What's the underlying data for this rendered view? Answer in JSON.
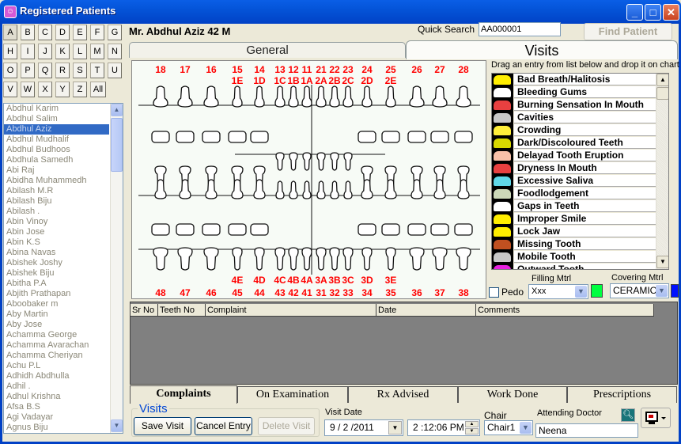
{
  "window": {
    "title": "Registered Patients",
    "buttons": {
      "minimize": "_",
      "maximize": "□",
      "close": "✕"
    }
  },
  "alphabet": [
    "A",
    "B",
    "C",
    "D",
    "E",
    "F",
    "G",
    "H",
    "I",
    "J",
    "K",
    "L",
    "M",
    "N",
    "O",
    "P",
    "Q",
    "R",
    "S",
    "T",
    "U",
    "V",
    "W",
    "X",
    "Y",
    "Z",
    "All"
  ],
  "alphabet_selected": "A",
  "patients": [
    "Abdhul Karim",
    "Abdhul Salim",
    "Abdhul Aziz",
    "Abdhul Mudhalif",
    "Abdhul Budhoos",
    "Abdhula Samedh",
    "Abi Raj",
    "Abidha Muhammedh",
    "Abilash M.R",
    "Abilash Biju",
    "Abilash .",
    "Abin Vinoy",
    "Abin Jose",
    "Abin K.S",
    "Abina Navas",
    "Abishek Joshy",
    "Abishek Biju",
    "Abitha P.A",
    "Abjith Prathapan",
    "Aboobaker m",
    "Aby Martin",
    "Aby Jose",
    "Achamma George",
    "Achamma Avarachan",
    "Achamma Cheriyan",
    "Achu P.L",
    "Adhidh Abdhulla",
    "Adhil .",
    "Adhul Krishna",
    "Afsa B.S",
    "Agi Vadayar",
    "Agnus Biju"
  ],
  "selected_patient_index": 2,
  "patient_header": "Mr. Abdhul  Aziz 42 M",
  "quick_search": {
    "label": "Quick Search",
    "value": "AA000001"
  },
  "find_patient_label": "Find Patient",
  "top_tabs": [
    {
      "label": "General",
      "active": false
    },
    {
      "label": "Visits",
      "active": true
    }
  ],
  "tooth_chart": {
    "upper_permanent": [
      "18",
      "17",
      "16",
      "15",
      "14",
      "13",
      "12",
      "11",
      "21",
      "22",
      "23",
      "24",
      "25",
      "26",
      "27",
      "28"
    ],
    "upper_primary": [
      "1E",
      "1D",
      "1C",
      "1B",
      "1A",
      "2A",
      "2B",
      "2C",
      "2D",
      "2E"
    ],
    "lower_primary": [
      "4E",
      "4D",
      "4C",
      "4B",
      "4A",
      "3A",
      "3B",
      "3C",
      "3D",
      "3E"
    ],
    "lower_permanent": [
      "48",
      "47",
      "46",
      "45",
      "44",
      "43",
      "42",
      "41",
      "31",
      "32",
      "33",
      "34",
      "35",
      "36",
      "37",
      "38"
    ],
    "label_color": "#ff0000"
  },
  "complaint_picker": {
    "hint": "Drag an entry from list below and drop it on chart",
    "items": [
      {
        "label": "Bad Breath/Halitosis",
        "icon": "yellow-face-icon",
        "color": "#ffee00"
      },
      {
        "label": "Bleeding Gums",
        "icon": "white-teeth-icon",
        "color": "#ffffff"
      },
      {
        "label": "Burning Sensation In Mouth",
        "icon": "red-mouth-icon",
        "color": "#e84040"
      },
      {
        "label": "Cavities",
        "icon": "cavity-icon",
        "color": "#c8c8c8"
      },
      {
        "label": "Crowding",
        "icon": "yellow-teeth-icon",
        "color": "#ffef3b"
      },
      {
        "label": "Dark/Discoloured Teeth",
        "icon": "dark-teeth-icon",
        "color": "#d8d800"
      },
      {
        "label": "Delayad Tooth Eruption",
        "icon": "gum-icon",
        "color": "#f8c0a8"
      },
      {
        "label": "Dryness In Mouth",
        "icon": "open-mouth-icon",
        "color": "#e84040"
      },
      {
        "label": "Excessive Saliva",
        "icon": "saliva-icon",
        "color": "#60d8e8"
      },
      {
        "label": "Foodlodgement",
        "icon": "food-icon",
        "color": "#ccd8b8"
      },
      {
        "label": "Gaps in Teeth",
        "icon": "gap-icon",
        "color": "#ffffff"
      },
      {
        "label": "Improper Smile",
        "icon": "smile-icon",
        "color": "#ffee00"
      },
      {
        "label": "Lock Jaw",
        "icon": "lock-icon",
        "color": "#ffee00"
      },
      {
        "label": "Missing  Tooth",
        "icon": "missing-tooth-icon",
        "color": "#c05020"
      },
      {
        "label": "Mobile Tooth",
        "icon": "mobile-tooth-icon",
        "color": "#c8c8c8"
      },
      {
        "label": "Outward Tooth",
        "icon": "pink-face-icon",
        "color": "#e820e0"
      }
    ]
  },
  "pedo": {
    "label": "Pedo",
    "checked": false
  },
  "filling": {
    "label": "Filling Mtrl",
    "value": "Xxx",
    "color": "#00ff40"
  },
  "covering": {
    "label": "Covering Mtrl",
    "value": "CERAMIC",
    "color": "#0010ff"
  },
  "grid": {
    "columns": [
      "Sr No",
      "Teeth No",
      "Complaint",
      "Date",
      "Comments"
    ],
    "rows": []
  },
  "bottom_tabs": [
    {
      "label": "Complaints",
      "active": true
    },
    {
      "label": "On Examination",
      "active": false
    },
    {
      "label": "Rx Advised",
      "active": false
    },
    {
      "label": "Work Done",
      "active": false
    },
    {
      "label": "Prescriptions",
      "active": false
    }
  ],
  "visits_panel": {
    "title": "Visits",
    "save": "Save Visit",
    "cancel": "Cancel Entry",
    "delete": "Delete Visit"
  },
  "visit_date": {
    "label": "Visit Date",
    "date": "9 / 2 /2011",
    "time": "2 :12:06 PM"
  },
  "chair": {
    "label": "Chair",
    "value": "Chair1"
  },
  "doctor": {
    "label": "Attending Doctor",
    "value": "Neena"
  }
}
